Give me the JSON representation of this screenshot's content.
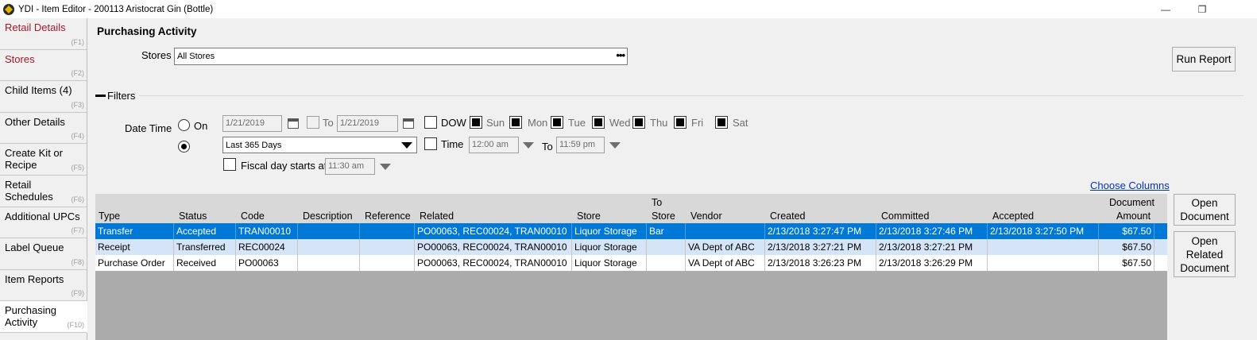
{
  "window": {
    "title": "YDI - Item Editor - 200113 Aristocrat Gin (Bottle)",
    "minimize": "—",
    "restore": "❐"
  },
  "sidebar": {
    "items": [
      {
        "label": "Retail Details",
        "key": "(F1)"
      },
      {
        "label": "Stores",
        "key": "(F2)"
      },
      {
        "label": "Child Items (4)",
        "key": "(F3)"
      },
      {
        "label": "Other Details",
        "key": "(F4)"
      },
      {
        "label": "Create Kit or Recipe",
        "key": "(F5)"
      },
      {
        "label": "Retail Schedules",
        "key": "(F6)"
      },
      {
        "label": "Additional UPCs",
        "key": "(F7)"
      },
      {
        "label": "Label Queue",
        "key": "(F8)"
      },
      {
        "label": "Item Reports",
        "key": "(F9)"
      },
      {
        "label": "Purchasing Activity",
        "key": "(F10)"
      }
    ]
  },
  "header": {
    "title": "Purchasing Activity",
    "stores_label": "Stores",
    "stores_value": "All Stores",
    "stores_btn": "•••",
    "run_report": "Run Report"
  },
  "filters": {
    "label": "Filters",
    "date_time_label": "Date Time",
    "on_label": "On",
    "date_from": "1/21/2019",
    "to_label": "To",
    "date_to": "1/21/2019",
    "range_value": "Last 365 Days",
    "dow_label": "DOW",
    "days": [
      "Sun",
      "Mon",
      "Tue",
      "Wed",
      "Thu",
      "Fri",
      "Sat"
    ],
    "time_label": "Time",
    "time_from": "12:00 am",
    "time_to_label": "To",
    "time_to": "11:59 pm",
    "fiscal_label": "Fiscal day starts at",
    "fiscal_time": "11:30 am"
  },
  "choose_columns": "Choose Columns",
  "table": {
    "headers": {
      "type": "Type",
      "status": "Status",
      "code": "Code",
      "description": "Description",
      "reference": "Reference",
      "related": "Related",
      "store": "Store",
      "to_store_1": "To",
      "to_store_2": "Store",
      "vendor": "Vendor",
      "created": "Created",
      "committed": "Committed",
      "accepted": "Accepted",
      "amount_1": "Document",
      "amount_2": "Amount"
    },
    "rows": [
      {
        "type": "Transfer",
        "status": "Accepted",
        "code": "TRAN00010",
        "description": "",
        "reference": "",
        "related": "PO00063, REC00024, TRAN00010",
        "store": "Liquor Storage",
        "to_store": "Bar",
        "vendor": "",
        "created": "2/13/2018 3:27:47 PM",
        "committed": "2/13/2018 3:27:46 PM",
        "accepted": "2/13/2018 3:27:50 PM",
        "amount": "$67.50"
      },
      {
        "type": "Receipt",
        "status": "Transferred",
        "code": "REC00024",
        "description": "",
        "reference": "",
        "related": "PO00063, REC00024, TRAN00010",
        "store": "Liquor Storage",
        "to_store": "",
        "vendor": "VA Dept of ABC",
        "created": "2/13/2018 3:27:21 PM",
        "committed": "2/13/2018 3:27:21 PM",
        "accepted": "",
        "amount": "$67.50"
      },
      {
        "type": "Purchase Order",
        "status": "Received",
        "code": "PO00063",
        "description": "",
        "reference": "",
        "related": "PO00063, REC00024, TRAN00010",
        "store": "Liquor Storage",
        "to_store": "",
        "vendor": "VA Dept of ABC",
        "created": "2/13/2018 3:26:23 PM",
        "committed": "2/13/2018 3:26:29 PM",
        "accepted": "",
        "amount": "$67.50"
      }
    ]
  },
  "actions": {
    "open_document": "Open Document",
    "open_related": "Open Related Document"
  },
  "colors": {
    "accent_red": "#a3192d",
    "selection_blue": "#0078d7",
    "link_blue": "#0033cc"
  }
}
